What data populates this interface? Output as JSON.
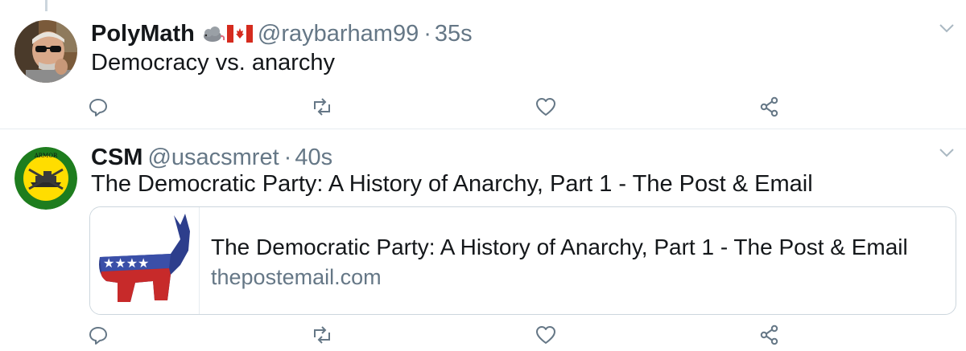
{
  "tweets": [
    {
      "name": "PolyMath",
      "handle": "@raybarham99",
      "separator": "·",
      "time": "35s",
      "text": "Democracy vs. anarchy",
      "badges": [
        "cloud-mouse-emoji",
        "canada-flag-emoji"
      ]
    },
    {
      "name": "CSM",
      "handle": "@usacsmret",
      "separator": "·",
      "time": "40s",
      "text": "The Democratic Party: A History of Anarchy, Part 1 - The Post & Email",
      "card": {
        "title": "The Democratic Party: A History of Anarchy, Part 1 - The Post & Email",
        "domain": "thepostemail.com",
        "thumbnail": "democratic-donkey-logo"
      }
    }
  ],
  "icons": [
    "reply-icon",
    "retweet-icon",
    "like-icon",
    "share-icon",
    "chevron-down-icon"
  ],
  "colors": {
    "text": "#14171a",
    "muted": "#657786",
    "icon": "#657786",
    "divider": "#e6ecf0",
    "border": "#ccd6dd"
  }
}
